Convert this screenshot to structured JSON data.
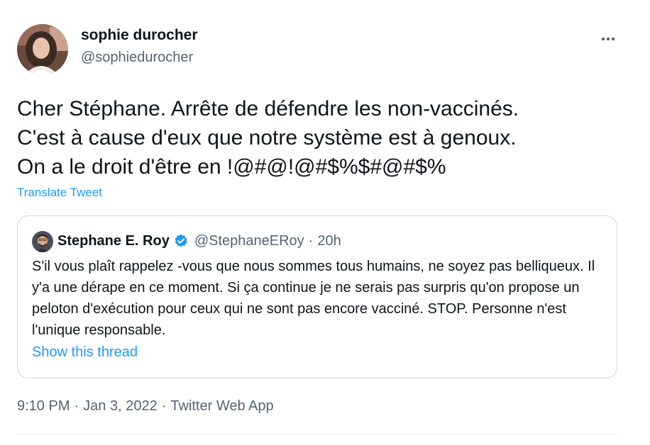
{
  "author": {
    "display_name": "sophie durocher",
    "handle": "@sophiedurocher"
  },
  "tweet": {
    "text": "Cher Stéphane. Arrête de défendre les non-vaccinés.\nC'est à cause d'eux que notre système est à genoux.\nOn a le droit d'être en !@#@!@#$%$#@#$%",
    "translate_label": "Translate Tweet"
  },
  "quoted_tweet": {
    "display_name": "Stephane E. Roy",
    "verified": true,
    "handle": "@StephaneERoy",
    "separator": "·",
    "time": "20h",
    "text": "S'il vous plaît rappelez -vous que nous sommes tous humains, ne soyez pas belliqueux. Il y'a une dérape en ce moment.  Si ça continue je ne serais pas surpris qu'on propose un peloton d'exécution pour ceux qui ne sont pas encore vacciné. STOP. Personne n'est l'unique responsable.",
    "show_thread_label": "Show this thread"
  },
  "meta": {
    "time": "9:10 PM",
    "separator": "·",
    "date": "Jan 3, 2022",
    "source": "Twitter Web App"
  },
  "icons": {
    "more": "more-horizontal-icon",
    "verified": "verified-badge-icon"
  },
  "colors": {
    "link": "#1d9bf0",
    "secondary_text": "#536471",
    "primary_text": "#0f1419",
    "border": "#cfd9de"
  }
}
